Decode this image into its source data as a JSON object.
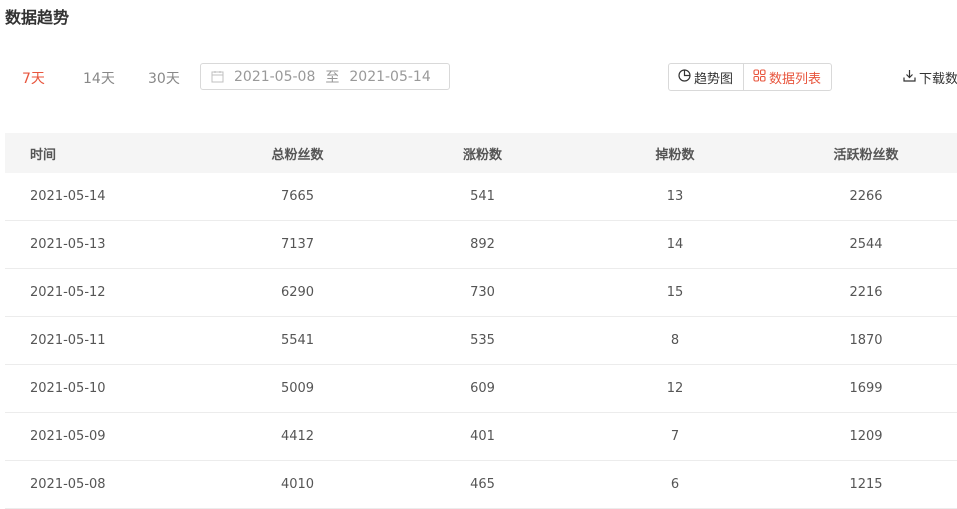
{
  "page": {
    "title": "数据趋势"
  },
  "range_tabs": [
    {
      "label": "7天",
      "active": true
    },
    {
      "label": "14天",
      "active": false
    },
    {
      "label": "30天",
      "active": false
    }
  ],
  "date_range": {
    "start": "2021-05-08",
    "separator": "至",
    "end": "2021-05-14"
  },
  "view_toggle": {
    "trend_label": "趋势图",
    "list_label": "数据列表",
    "active": "list"
  },
  "download": {
    "label": "下载数"
  },
  "table": {
    "headers": [
      "时间",
      "总粉丝数",
      "涨粉数",
      "掉粉数",
      "活跃粉丝数"
    ],
    "rows": [
      [
        "2021-05-14",
        "7665",
        "541",
        "13",
        "2266"
      ],
      [
        "2021-05-13",
        "7137",
        "892",
        "14",
        "2544"
      ],
      [
        "2021-05-12",
        "6290",
        "730",
        "15",
        "2216"
      ],
      [
        "2021-05-11",
        "5541",
        "535",
        "8",
        "1870"
      ],
      [
        "2021-05-10",
        "5009",
        "609",
        "12",
        "1699"
      ],
      [
        "2021-05-09",
        "4412",
        "401",
        "7",
        "1209"
      ],
      [
        "2021-05-08",
        "4010",
        "465",
        "6",
        "1215"
      ]
    ]
  },
  "colors": {
    "accent": "#e8553d",
    "header_bg": "#f5f5f5",
    "border": "#d9d9d9",
    "muted_text": "#888888"
  }
}
